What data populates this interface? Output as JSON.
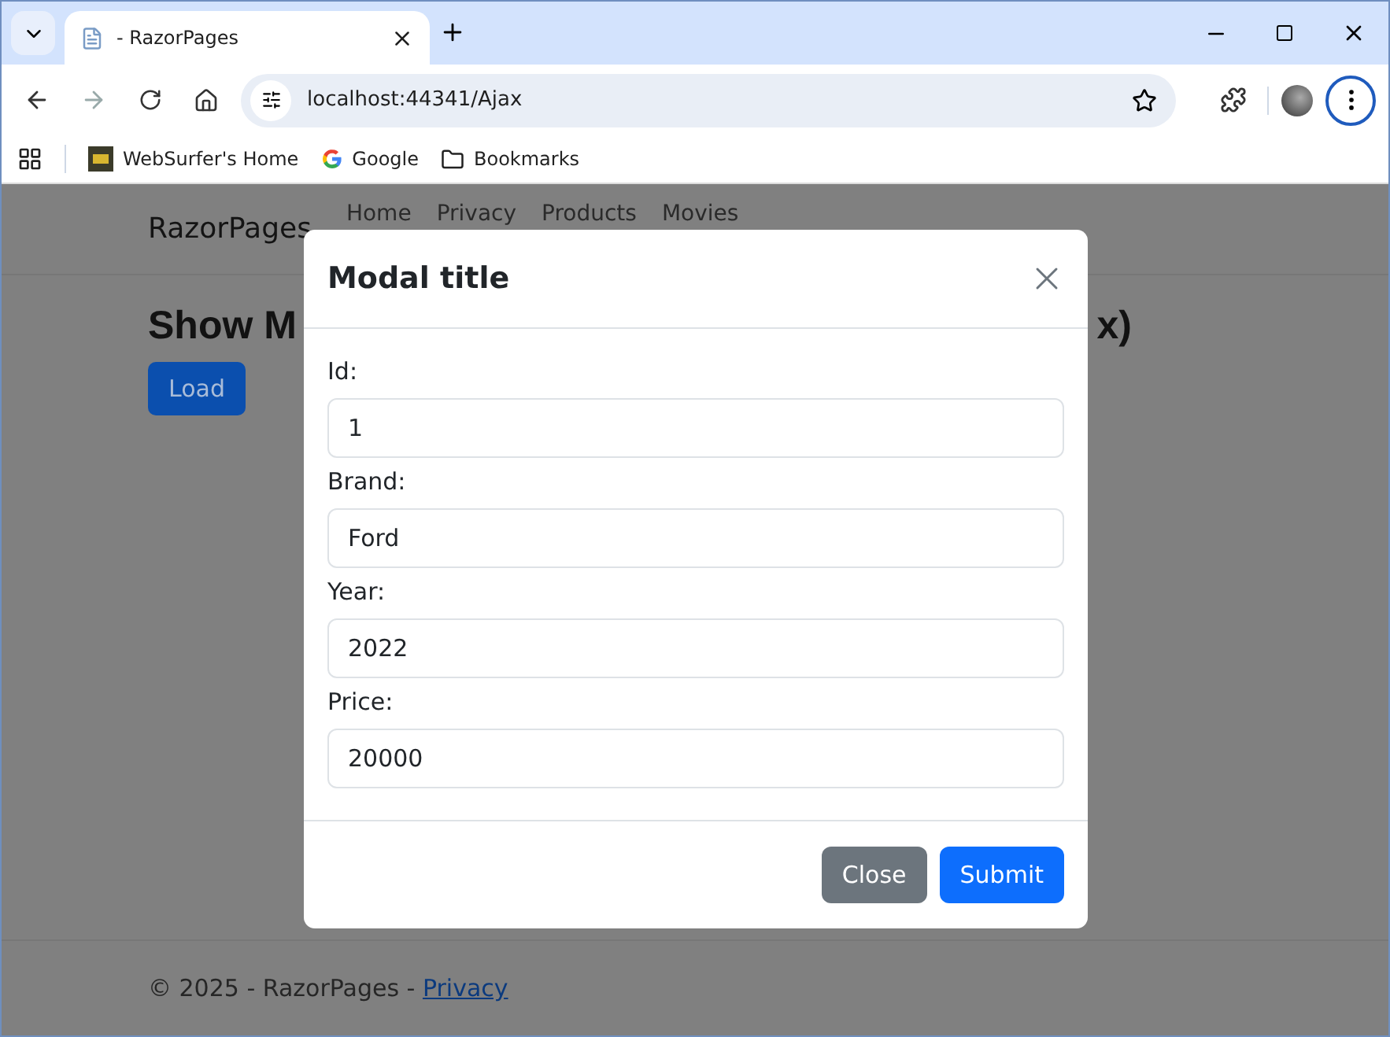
{
  "browser": {
    "tab_title": "- RazorPages",
    "address": "localhost:44341/Ajax",
    "bookmarks": [
      {
        "label": "WebSurfer's Home",
        "kind": "site"
      },
      {
        "label": "Google",
        "kind": "google"
      },
      {
        "label": "Bookmarks",
        "kind": "folder"
      }
    ]
  },
  "navbar": {
    "brand": "RazorPages",
    "links": [
      "Home",
      "Privacy",
      "Products",
      "Movies"
    ]
  },
  "heading_left": "Show M",
  "heading_right": "x)",
  "load_button": "Load",
  "modal": {
    "title": "Modal title",
    "fields": [
      {
        "label": "Id:",
        "value": "1"
      },
      {
        "label": "Brand:",
        "value": "Ford"
      },
      {
        "label": "Year:",
        "value": "2022"
      },
      {
        "label": "Price:",
        "value": "20000"
      }
    ],
    "buttons": [
      {
        "label": "Close",
        "kind": "secondary"
      },
      {
        "label": "Submit",
        "kind": "primary"
      }
    ]
  },
  "footer": {
    "text": "© 2025 - RazorPages - ",
    "link": "Privacy"
  }
}
